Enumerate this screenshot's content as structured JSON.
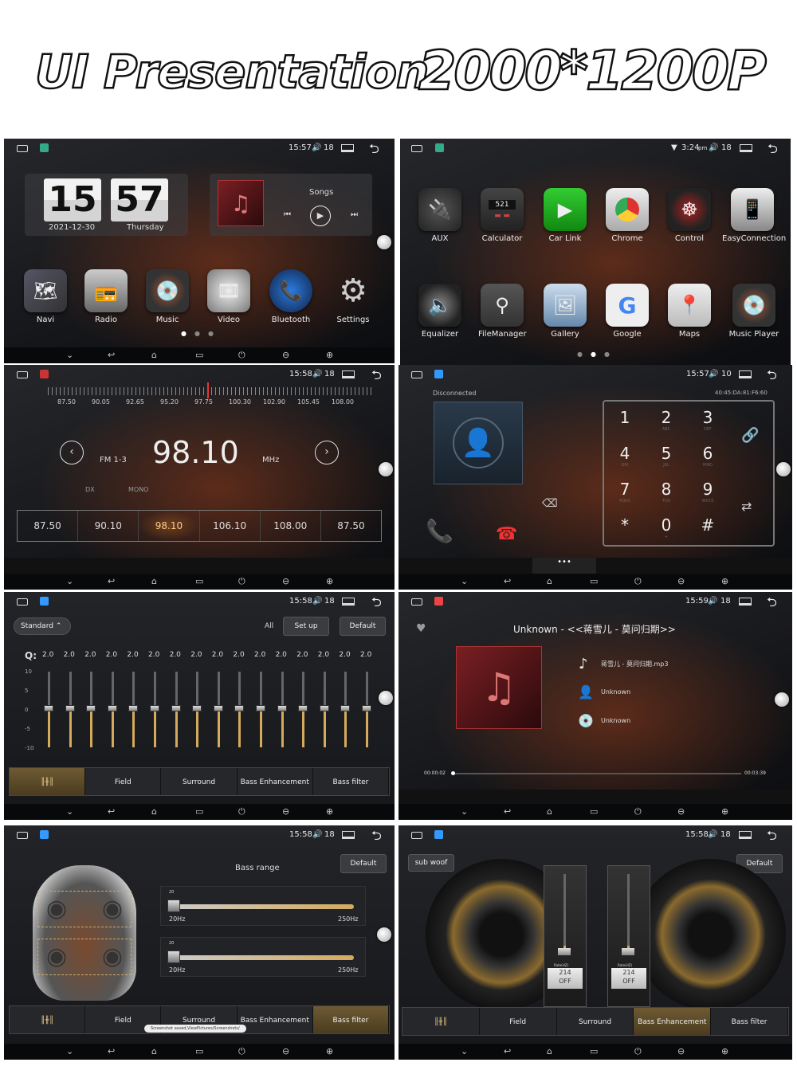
{
  "header": {
    "left": "UI Presentation",
    "right": "2000*1200P"
  },
  "nav": {
    "down": "⌄",
    "back": "↩",
    "home": "⌂",
    "recent": "▭",
    "power": "⏻",
    "vol_down": "⊖",
    "vol_up": "⊕"
  },
  "home": {
    "clock": "15:57",
    "vol": "18",
    "hour": "15",
    "minute": "57",
    "date": "2021-12-30",
    "weekday": "Thursday",
    "songs": "Songs",
    "apps": [
      "Navi",
      "Radio",
      "Music",
      "Video",
      "Bluetooth",
      "Settings"
    ]
  },
  "apps": {
    "clock": "3:24",
    "ampm": "pm",
    "vol": "18",
    "row1": [
      "AUX",
      "Calculator",
      "Car Link",
      "Chrome",
      "Control",
      "EasyConnection"
    ],
    "row2": [
      "Equalizer",
      "FileManager",
      "Gallery",
      "Google",
      "Maps",
      "Music Player"
    ],
    "calc_display": "521"
  },
  "radio": {
    "clock": "15:58",
    "vol": "18",
    "scale": [
      "87.50",
      "90.05",
      "92.65",
      "95.20",
      "97.75",
      "100.30",
      "102.90",
      "105.45",
      "108.00"
    ],
    "band": "FM 1-3",
    "freq": "98.10",
    "unit": "MHz",
    "dx": "DX",
    "mono": "MONO",
    "presets": [
      "87.50",
      "90.10",
      "98.10",
      "106.10",
      "108.00",
      "87.50"
    ]
  },
  "phone": {
    "clock": "15:57",
    "vol": "10",
    "status": "Disconnected",
    "mac": "40:45:DA:81:F6:60",
    "keys": [
      [
        "1",
        ""
      ],
      [
        "2",
        "ABC"
      ],
      [
        "3",
        "DEF"
      ],
      [
        "4",
        "GHI"
      ],
      [
        "5",
        "JKL"
      ],
      [
        "6",
        "MNO"
      ],
      [
        "7",
        "PQRS"
      ],
      [
        "8",
        "TUV"
      ],
      [
        "9",
        "WXYZ"
      ],
      [
        "*",
        ""
      ],
      [
        "0",
        "+"
      ],
      [
        "#",
        ""
      ]
    ]
  },
  "eq": {
    "clock": "15:58",
    "vol": "18",
    "preset": "Standard",
    "all": "All",
    "setup": "Set up",
    "default": "Default",
    "q": "Q:",
    "qvals": [
      "2.0",
      "2.0",
      "2.0",
      "2.0",
      "2.0",
      "2.0",
      "2.0",
      "2.0",
      "2.0",
      "2.0",
      "2.0",
      "2.0",
      "2.0",
      "2.0",
      "2.0",
      "2.0"
    ],
    "scale": [
      "10",
      "5",
      "0",
      "-5",
      "-10"
    ],
    "tabs": [
      "",
      "Field",
      "Surround",
      "Bass Enhancement",
      "Bass filter"
    ]
  },
  "music": {
    "clock": "15:59",
    "vol": "18",
    "title": "Unknown - <<蒋雪儿 - 莫问归期>>",
    "file": "蒋雪儿 - 莫问归期.mp3",
    "artist": "Unknown",
    "album": "Unknown",
    "elapsed": "00:00:02",
    "total": "00:03:39"
  },
  "bass": {
    "clock": "15:58",
    "vol": "18",
    "title": "Bass range",
    "default": "Default",
    "s1_val": "20",
    "s1_min": "20Hz",
    "s1_max": "250Hz",
    "s2_val": "20",
    "s2_min": "20Hz",
    "s2_max": "250Hz",
    "toast": "Screenshot saved,ViewPictures/Screenshots/",
    "tabs": [
      "",
      "Field",
      "Surround",
      "Bass Enhancement",
      "Bass filter"
    ]
  },
  "sub": {
    "clock": "15:58",
    "vol": "18",
    "label": "sub woof",
    "default": "Default",
    "rate_label": "Rate(HZ)",
    "rate1": "214",
    "rate2": "214",
    "off": "OFF",
    "tabs": [
      "",
      "Field",
      "Surround",
      "Bass Enhancement",
      "Bass filter"
    ]
  }
}
